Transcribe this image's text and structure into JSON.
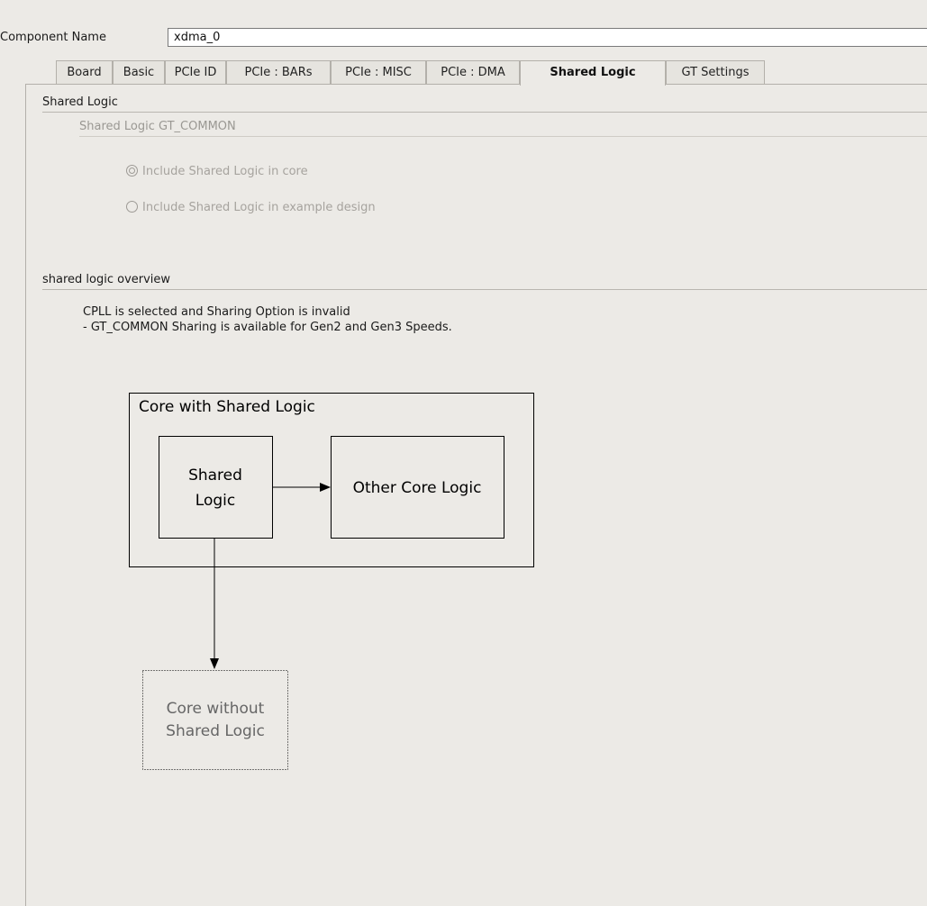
{
  "component": {
    "label": "Component Name",
    "value": "xdma_0"
  },
  "tabs": [
    {
      "label": "Board"
    },
    {
      "label": "Basic"
    },
    {
      "label": "PCIe ID"
    },
    {
      "label": "PCIe : BARs"
    },
    {
      "label": "PCIe : MISC"
    },
    {
      "label": "PCIe : DMA"
    },
    {
      "label": "Shared Logic",
      "active": true
    },
    {
      "label": "GT Settings"
    }
  ],
  "shared_logic": {
    "title": "Shared Logic",
    "subsection_title": "Shared Logic GT_COMMON",
    "options": [
      {
        "label": "Include Shared Logic in core",
        "checked": true
      },
      {
        "label": "Include Shared Logic in example design",
        "checked": false
      }
    ]
  },
  "overview": {
    "title": "shared logic overview",
    "line1": "CPLL is selected and Sharing Option is invalid",
    "line2": "- GT_COMMON Sharing is available for Gen2 and Gen3 Speeds."
  },
  "diagram": {
    "outer_label": "Core with Shared Logic",
    "shared_line1": "Shared",
    "shared_line2": "Logic",
    "other_label": "Other Core Logic",
    "without_line1": "Core without",
    "without_line2": "Shared Logic"
  }
}
